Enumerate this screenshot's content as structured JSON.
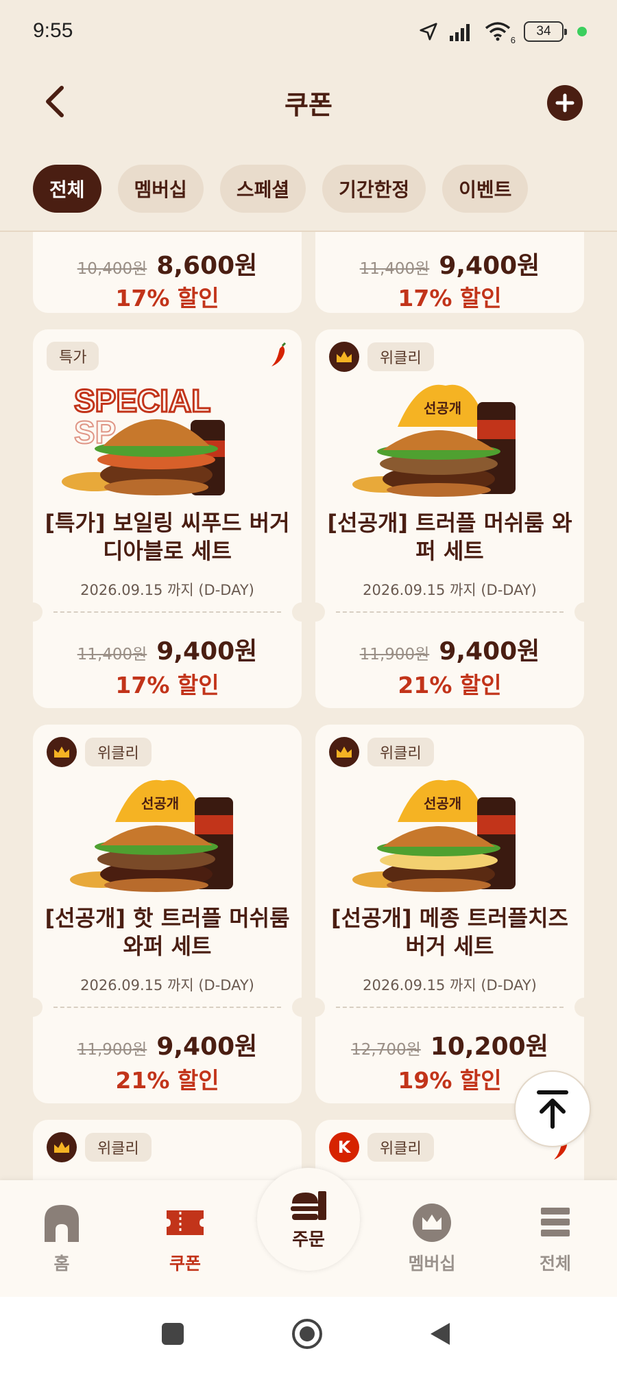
{
  "status_bar": {
    "time": "9:55",
    "wifi_sub": "6",
    "battery": "34"
  },
  "header": {
    "title": "쿠폰"
  },
  "tabs": [
    {
      "label": "전체",
      "active": true
    },
    {
      "label": "멤버십",
      "active": false
    },
    {
      "label": "스페셜",
      "active": false
    },
    {
      "label": "기간한정",
      "active": false
    },
    {
      "label": "이벤트",
      "active": false
    }
  ],
  "partial_top": [
    {
      "old_price": "10,400원",
      "new_price": "8,600원",
      "discount": "17% 할인"
    },
    {
      "old_price": "11,400원",
      "new_price": "9,400원",
      "discount": "17% 할인"
    }
  ],
  "coupons": [
    {
      "tag": "특가",
      "title": "[특가] 보일링 씨푸드 버거 디아블로 세트",
      "date": "2026.09.15 까지  (D-DAY)",
      "old_price": "11,400원",
      "new_price": "9,400원",
      "discount": "17% 할인",
      "image_text": "SPECIAL"
    },
    {
      "tag": "위클리",
      "title": "[선공개] 트러플 머쉬룸 와퍼 세트",
      "date": "2026.09.15 까지  (D-DAY)",
      "old_price": "11,900원",
      "new_price": "9,400원",
      "discount": "21% 할인",
      "image_text": "선공개"
    },
    {
      "tag": "위클리",
      "title": "[선공개] 핫 트러플 머쉬룸 와퍼 세트",
      "date": "2026.09.15 까지  (D-DAY)",
      "old_price": "11,900원",
      "new_price": "9,400원",
      "discount": "21% 할인",
      "image_text": "선공개"
    },
    {
      "tag": "위클리",
      "title": "[선공개] 메종 트러플치즈 버거 세트",
      "date": "2026.09.15 까지  (D-DAY)",
      "old_price": "12,700원",
      "new_price": "10,200원",
      "discount": "19% 할인",
      "image_text": "선공개"
    }
  ],
  "partial_bottom": [
    {
      "tag": "위클리"
    },
    {
      "tag": "위클리",
      "badge": "K"
    }
  ],
  "bottom_nav": {
    "home": "홈",
    "coupon": "쿠폰",
    "order": "주문",
    "membership": "멤버십",
    "all": "전체"
  },
  "colors": {
    "brand_dark": "#4a1e12",
    "accent_red": "#c2341a",
    "background": "#f3ebdf"
  }
}
